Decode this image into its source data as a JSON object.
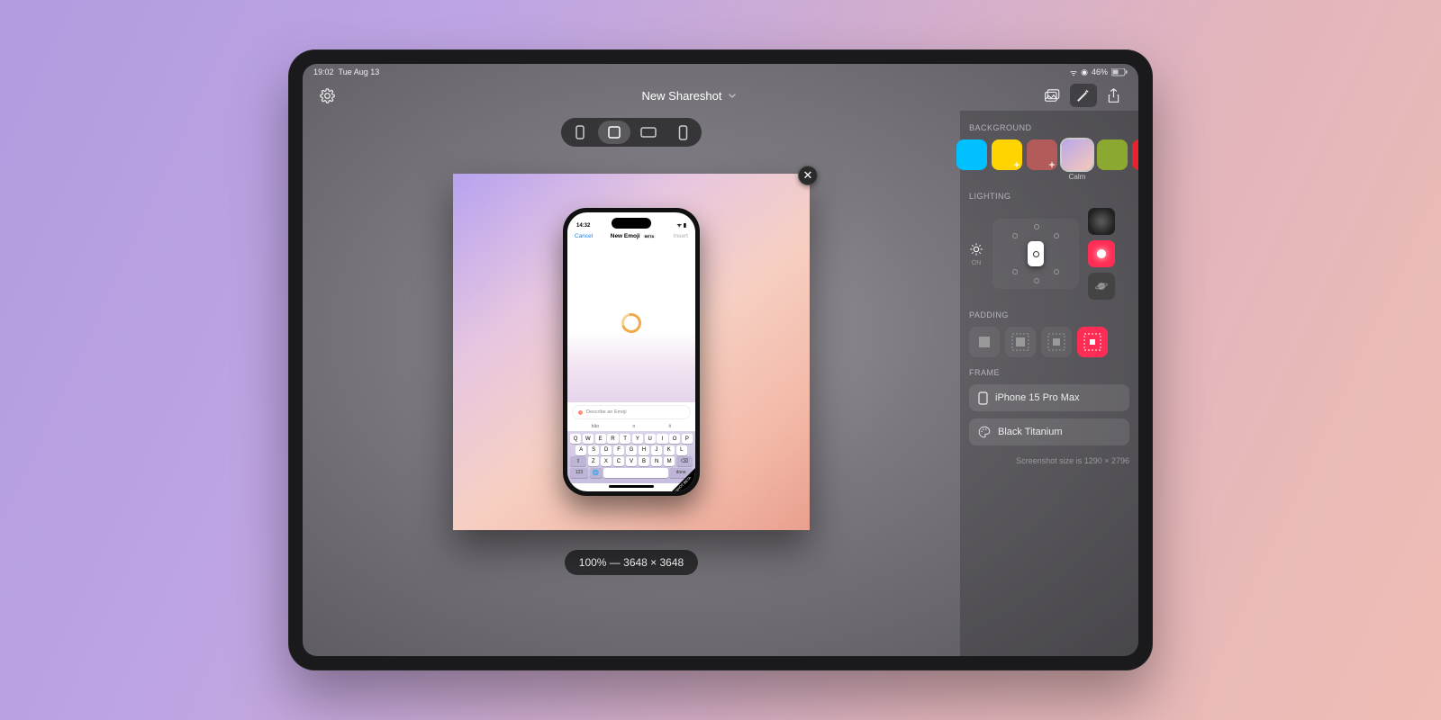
{
  "status": {
    "time": "19:02",
    "date": "Tue Aug 13",
    "battery_pct": "46%"
  },
  "toolbar": {
    "title": "New Shareshot",
    "icons": {
      "settings": "gear-icon",
      "photos": "photos-icon",
      "magic": "sparkle-icon",
      "share": "share-icon",
      "chevron": "chevron-down-icon"
    }
  },
  "aspects": {
    "selected_index": 1
  },
  "zoom": {
    "label": "100% — 3648 × 3648"
  },
  "phone": {
    "status_time": "14:32",
    "nav_cancel": "Cancel",
    "nav_title": "New Emoji",
    "nav_badge": "BETA",
    "nav_insert": "Insert",
    "input_placeholder": "Describe an Emoji",
    "suggest_left": "hǎo",
    "suggest_mid": "o",
    "suggest_right": "ō",
    "row1": [
      "Q",
      "W",
      "E",
      "R",
      "T",
      "Y",
      "U",
      "I",
      "O",
      "P"
    ],
    "row2": [
      "A",
      "S",
      "D",
      "F",
      "G",
      "H",
      "J",
      "K",
      "L"
    ],
    "row3": [
      "Z",
      "X",
      "C",
      "V",
      "B",
      "N",
      "M"
    ],
    "key_123": "123",
    "key_done": "done",
    "corner": "SHARESHOT BETA"
  },
  "sidebar": {
    "background_label": "BACKGROUND",
    "swatches": [
      {
        "color": "#00c0ff",
        "sparkle": false
      },
      {
        "color": "#ffd400",
        "sparkle": true
      },
      {
        "color": "#b35a5a",
        "sparkle": true
      },
      {
        "gradientA": "#b8a6ec",
        "gradientB": "#f6c9b8",
        "sparkle": false,
        "selected": true,
        "label": "Calm"
      },
      {
        "color": "#8ba831",
        "sparkle": false
      },
      {
        "color": "#e6232e",
        "sparkle": false
      }
    ],
    "lighting_label": "LIGHTING",
    "lighting_on": "ON",
    "padding_label": "PADDING",
    "padding_selected": 3,
    "frame_label": "FRAME",
    "frame_device": "iPhone 15 Pro Max",
    "frame_color": "Black Titanium",
    "size_hint": "Screenshot size is 1290 × 2796"
  }
}
